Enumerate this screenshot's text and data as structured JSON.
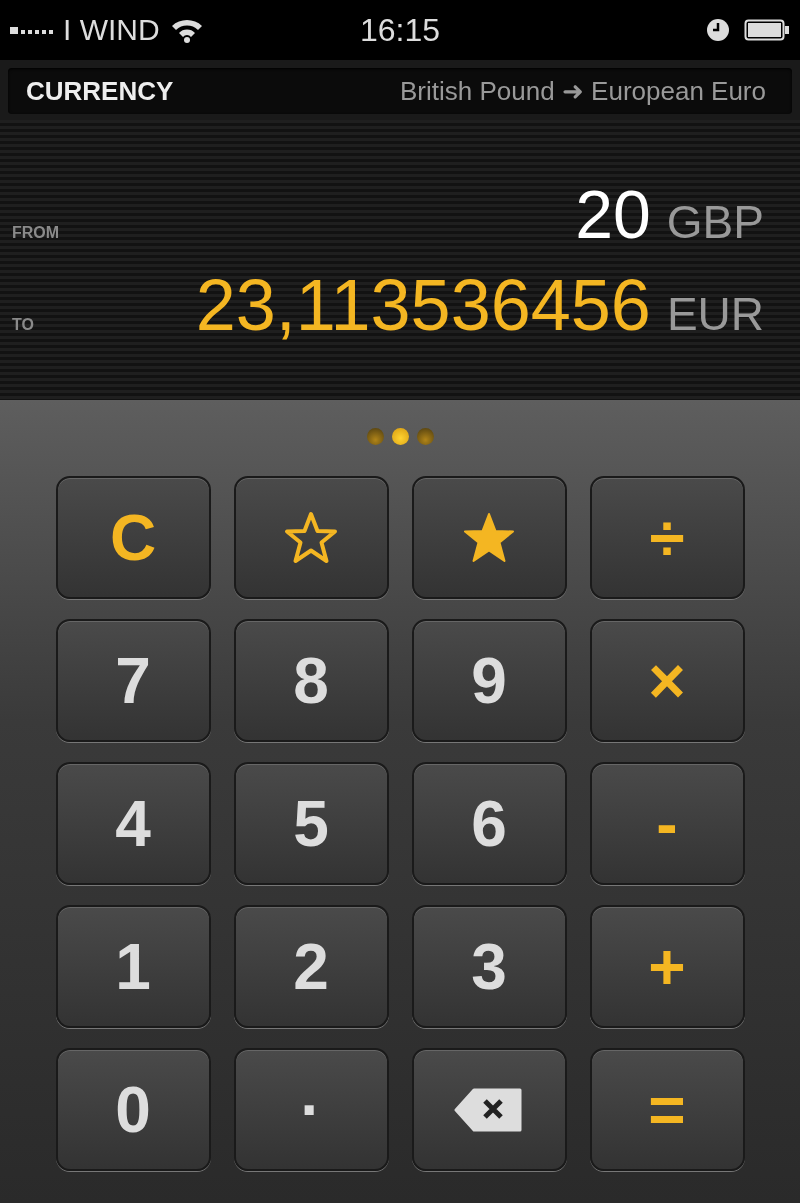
{
  "status_bar": {
    "carrier": "I WIND",
    "time": "16:15"
  },
  "header": {
    "title": "CURRENCY",
    "conversion": "British Pound ➜ European Euro"
  },
  "display": {
    "from": {
      "label": "FROM",
      "amount": "20",
      "currency": "GBP"
    },
    "to": {
      "label": "TO",
      "amount": "23,113536456",
      "currency": "EUR"
    }
  },
  "page_dots": [
    {
      "selected": false
    },
    {
      "selected": true
    },
    {
      "selected": false
    }
  ],
  "keys": [
    {
      "kind": "operator",
      "label": "C"
    },
    {
      "kind": "star-outline"
    },
    {
      "kind": "star-filled"
    },
    {
      "kind": "operator",
      "label": "÷"
    },
    {
      "kind": "digit",
      "label": "7"
    },
    {
      "kind": "digit",
      "label": "8"
    },
    {
      "kind": "digit",
      "label": "9"
    },
    {
      "kind": "operator",
      "label": "×"
    },
    {
      "kind": "digit",
      "label": "4"
    },
    {
      "kind": "digit",
      "label": "5"
    },
    {
      "kind": "digit",
      "label": "6"
    },
    {
      "kind": "operator",
      "label": "-"
    },
    {
      "kind": "digit",
      "label": "1"
    },
    {
      "kind": "digit",
      "label": "2"
    },
    {
      "kind": "digit",
      "label": "3"
    },
    {
      "kind": "operator",
      "label": "+"
    },
    {
      "kind": "digit",
      "label": "0"
    },
    {
      "kind": "digit",
      "label": "·"
    },
    {
      "kind": "backspace"
    },
    {
      "kind": "operator",
      "label": "="
    }
  ]
}
